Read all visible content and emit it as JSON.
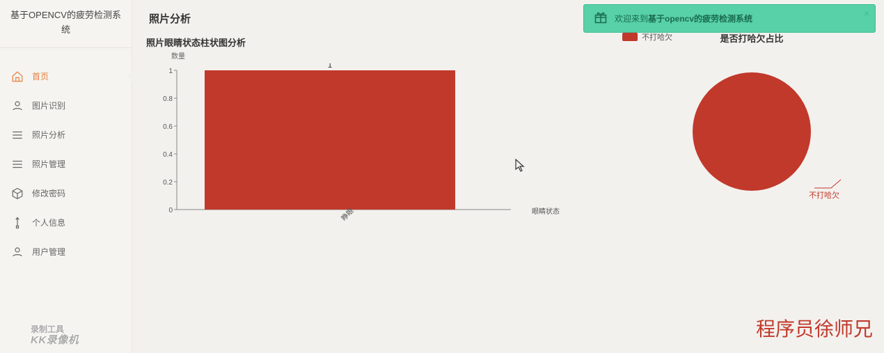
{
  "app_title": "基于OPENCV的疲劳检测系统",
  "sidebar": {
    "items": [
      {
        "label": "首页"
      },
      {
        "label": "图片识别"
      },
      {
        "label": "照片分析"
      },
      {
        "label": "照片管理"
      },
      {
        "label": "修改密码"
      },
      {
        "label": "个人信息"
      },
      {
        "label": "用户管理"
      }
    ]
  },
  "header": {
    "title": "照片分析"
  },
  "toast": {
    "prefix": "欢迎来到",
    "bold": "基于opencv的疲劳检测系统"
  },
  "bar_chart": {
    "title": "照片眼睛状态柱状图分析",
    "y_title": "数量",
    "x_title": "眼睛状态",
    "legend": "不打哈欠"
  },
  "pie_chart": {
    "title": "是否打哈欠占比",
    "label": "不打哈欠"
  },
  "chart_data": [
    {
      "type": "bar",
      "title": "照片眼睛状态柱状图分析",
      "xlabel": "眼睛状态",
      "ylabel": "数量",
      "categories": [
        "睁眼"
      ],
      "series": [
        {
          "name": "不打哈欠",
          "values": [
            1
          ]
        }
      ],
      "ylim": [
        0,
        1
      ],
      "y_ticks": [
        0,
        0.2,
        0.4,
        0.6,
        0.8,
        1
      ]
    },
    {
      "type": "pie",
      "title": "是否打哈欠占比",
      "slices": [
        {
          "name": "不打哈欠",
          "value": 1
        }
      ]
    }
  ],
  "watermarks": {
    "br": "程序员徐师兄",
    "bl_line1": "录制工具",
    "bl_line2": "KK录像机"
  },
  "bar_y_ticks": {
    "t0": "0",
    "t1": "0.2",
    "t2": "0.4",
    "t3": "0.6",
    "t4": "0.8",
    "t5": "1"
  },
  "bar_value_label": "1",
  "bar_category_label": "睁眼"
}
